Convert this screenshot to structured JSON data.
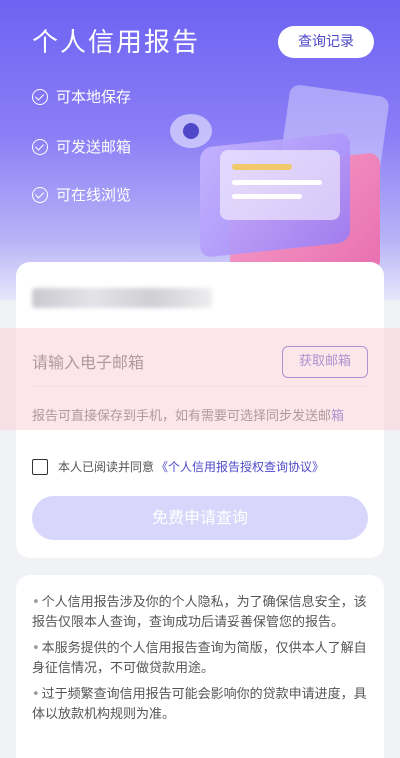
{
  "hero": {
    "title": "个人信用报告",
    "history_button": "查询记录",
    "features": [
      "可本地保存",
      "可发送邮箱",
      "可在线浏览"
    ]
  },
  "form": {
    "email_placeholder": "请输入电子邮箱",
    "get_email_button": "获取邮箱",
    "hint_text": "报告可直接保存到手机，如有需要可选择同步发送邮",
    "hint_link": "箱",
    "agree_text": "本人已阅读并同意",
    "agree_link": "《个人信用报告授权查询协议》",
    "submit_button": "免费申请查询"
  },
  "notes": [
    "个人信用报告涉及你的个人隐私，为了确保信息安全，该报告仅限本人查询，查询成功后请妥善保管您的报告。",
    "本服务提供的个人信用报告查询为简版，仅供本人了解自身征信情况，不可做贷款用途。",
    "过于频繁查询信用报告可能会影响你的贷款申请进度，具体以放款机构规则为准。"
  ],
  "colors": {
    "accent": "#4f49c9",
    "hero_top": "#6c63f2",
    "button_disabled": "#d8d6fb"
  }
}
